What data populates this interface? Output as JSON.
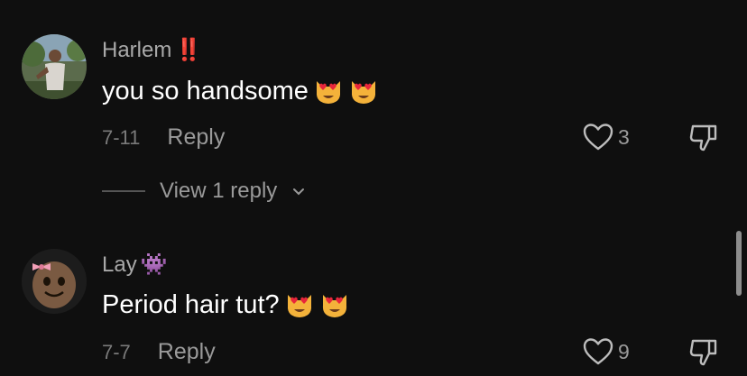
{
  "comments": [
    {
      "username": "Harlem",
      "name_emoji": "‼️",
      "text": "you so handsome",
      "emojis": [
        "heart-eyes-cat",
        "heart-eyes-cat"
      ],
      "date": "7-11",
      "reply_label": "Reply",
      "likes": "3",
      "avatar_icon": "man-in-park-avatar"
    },
    {
      "username": "Lay",
      "name_emoji": "👾",
      "text": "Period hair tut?",
      "emojis": [
        "heart-eyes-cat",
        "heart-eyes-cat"
      ],
      "date": "7-7",
      "reply_label": "Reply",
      "likes": "9",
      "avatar_icon": "sackboy-with-bow-avatar"
    }
  ],
  "view_replies_label": "View 1 reply",
  "colors": {
    "background": "#0f0f0f",
    "username": "#a9a9a9",
    "text": "#ffffff",
    "muted": "#9a9a9a"
  }
}
